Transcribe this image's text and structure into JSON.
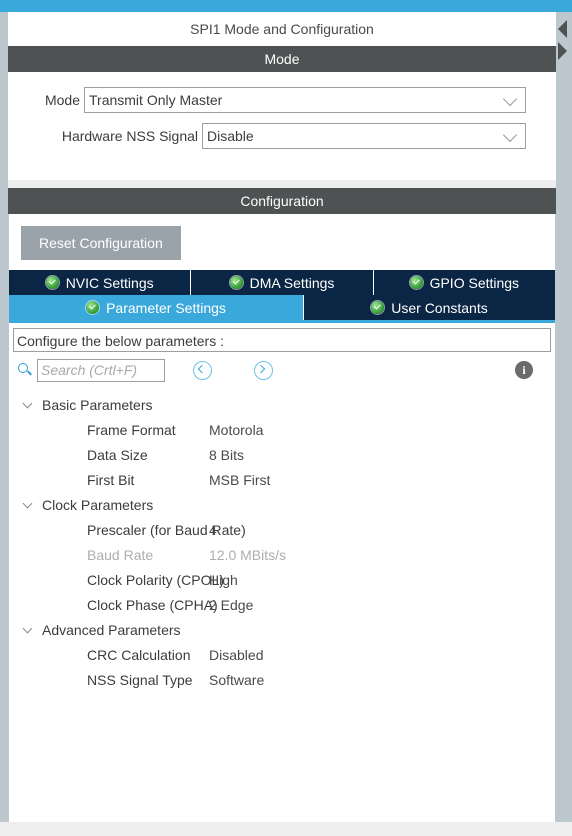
{
  "window": {
    "title": "SPI1 Mode and Configuration"
  },
  "edge": {
    "left_arrow": "collapse-left",
    "right_arrow": "expand-right"
  },
  "mode_section": {
    "header": "Mode",
    "fields": [
      {
        "label": "Mode",
        "value": "Transmit Only Master"
      },
      {
        "label": "Hardware NSS Signal",
        "value": "Disable"
      }
    ]
  },
  "configuration_section": {
    "header": "Configuration",
    "reset_button": "Reset Configuration",
    "tabs_row1": [
      {
        "label": "NVIC Settings",
        "active": false
      },
      {
        "label": "DMA Settings",
        "active": false
      },
      {
        "label": "GPIO Settings",
        "active": false
      }
    ],
    "tabs_row2": [
      {
        "label": "Parameter Settings",
        "active": true
      },
      {
        "label": "User Constants",
        "active": false
      }
    ],
    "hint": "Configure the below parameters :",
    "search": {
      "placeholder": "Search (Crtl+F)",
      "value": "",
      "prev_label": "",
      "next_label": "",
      "info_label": "i"
    },
    "groups": [
      {
        "name": "Basic Parameters",
        "rows": [
          {
            "name": "Frame Format",
            "value": "Motorola",
            "disabled": false
          },
          {
            "name": "Data Size",
            "value": "8 Bits",
            "disabled": false
          },
          {
            "name": "First Bit",
            "value": "MSB First",
            "disabled": false
          }
        ]
      },
      {
        "name": "Clock Parameters",
        "rows": [
          {
            "name": "Prescaler (for Baud Rate)",
            "value": "4",
            "disabled": false
          },
          {
            "name": "Baud Rate",
            "value": "12.0 MBits/s",
            "disabled": true
          },
          {
            "name": "Clock Polarity (CPOL)",
            "value": "High",
            "disabled": false
          },
          {
            "name": "Clock Phase (CPHA)",
            "value": "2 Edge",
            "disabled": false
          }
        ]
      },
      {
        "name": "Advanced Parameters",
        "rows": [
          {
            "name": "CRC Calculation",
            "value": "Disabled",
            "disabled": false
          },
          {
            "name": "NSS Signal Type",
            "value": "Software",
            "disabled": false
          }
        ]
      }
    ]
  },
  "colors": {
    "accent_blue": "#3aa8da",
    "tab_navy": "#0b2545",
    "section_bar": "#4f5253",
    "gutter": "#bcc7ce",
    "button_grey": "#9aa3aa",
    "check_green": "#3aa23a"
  }
}
